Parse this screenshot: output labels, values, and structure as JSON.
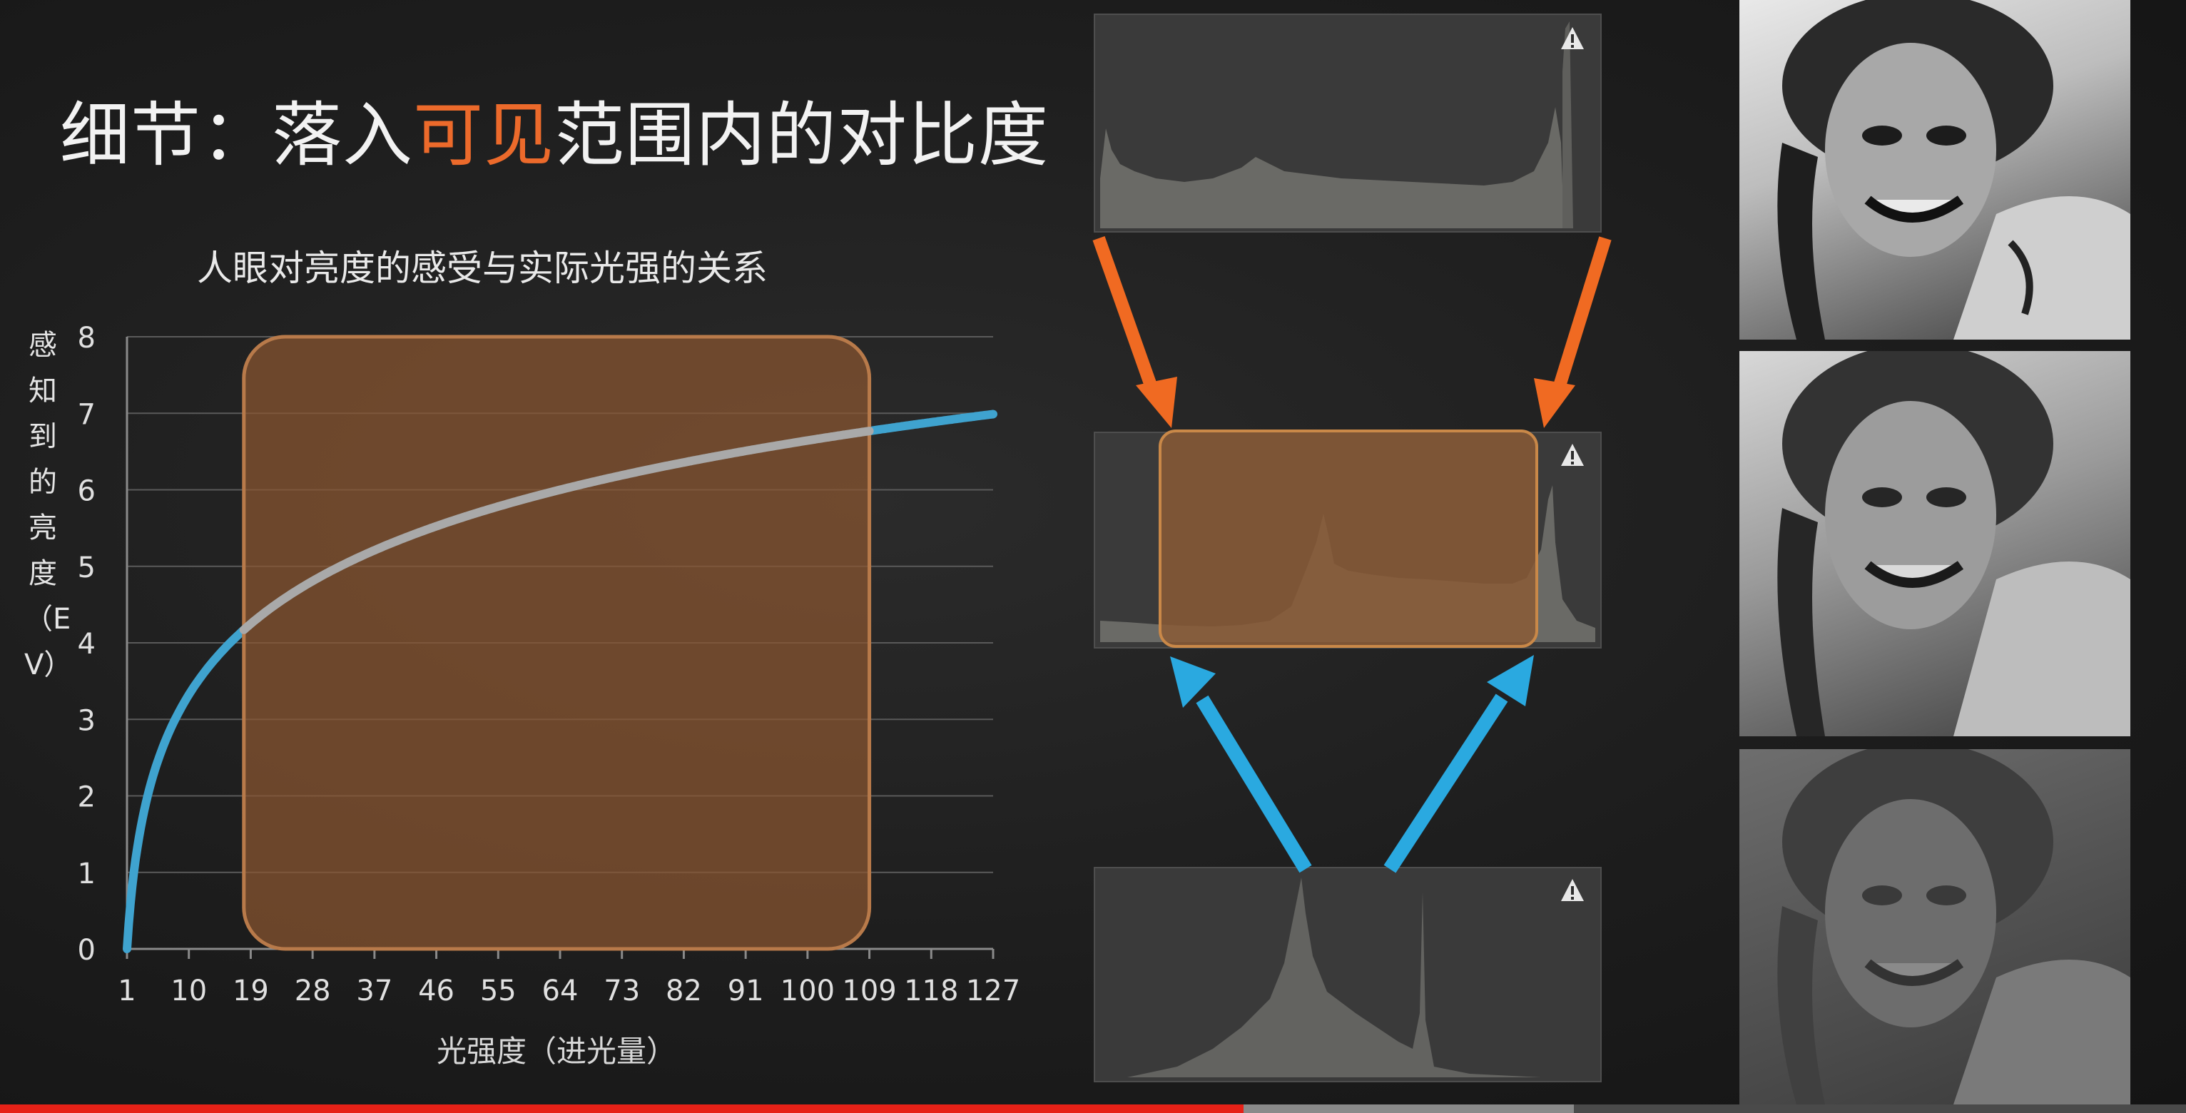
{
  "slide": {
    "title_prefix": "细节：落入",
    "title_highlight": "可见",
    "title_suffix": "范围内的对比度",
    "colors": {
      "highlight": "#ec6a2b",
      "orange_arrow": "#f06a22",
      "blue_arrow": "#2aa9e0",
      "box_fill": "#7a4a2a",
      "box_stroke": "#b87a4a"
    }
  },
  "chart_data": {
    "type": "line",
    "title": "人眼对亮度的感受与实际光强的关系",
    "xlabel": "光强度（进光量）",
    "ylabel": "感知到的亮度（EV）",
    "x_ticks": [
      "1",
      "10",
      "19",
      "28",
      "37",
      "46",
      "55",
      "64",
      "73",
      "82",
      "91",
      "100",
      "109",
      "118",
      "127"
    ],
    "y_ticks": [
      "0",
      "1",
      "2",
      "3",
      "4",
      "5",
      "6",
      "7",
      "8"
    ],
    "xlim": [
      1,
      127
    ],
    "ylim": [
      0,
      8
    ],
    "grid": true,
    "series": [
      {
        "x": [
          1,
          2,
          4,
          8,
          16,
          32,
          64,
          127
        ],
        "y": [
          0,
          1,
          2,
          3,
          4,
          5,
          6,
          7
        ]
      }
    ],
    "highlight_range": {
      "x": [
        18,
        109
      ],
      "y": [
        0,
        8
      ]
    }
  },
  "histograms": {
    "top": {
      "warning_icon": "warning-triangle-icon"
    },
    "middle": {
      "warning_icon": "warning-triangle-icon"
    },
    "bottom": {
      "warning_icon": "warning-triangle-icon"
    }
  },
  "photos": [
    {
      "label": "portrait-high-contrast"
    },
    {
      "label": "portrait-medium-contrast"
    },
    {
      "label": "portrait-low-contrast"
    }
  ],
  "player": {
    "progress_played": 0.569,
    "progress_buffered": 0.72
  }
}
